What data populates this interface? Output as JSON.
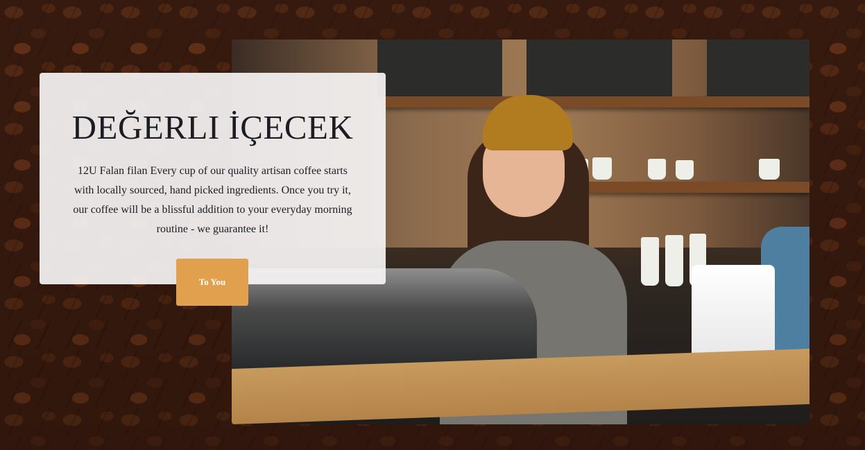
{
  "hero": {
    "title": "DEĞERLI İÇECEK",
    "description": "12U Falan filan Every cup of our quality artisan coffee starts with locally sourced, hand picked ingredients. Once you try it, our coffee will be a blissful addition to your everyday morning routine - we guarantee it!",
    "cta_label": "To You"
  },
  "colors": {
    "accent": "#e0a04e",
    "card_bg": "#f5f3f3",
    "text": "#1b1d22"
  },
  "icons": {
    "background": "coffee-beans-background",
    "photo": "barista-photo"
  }
}
